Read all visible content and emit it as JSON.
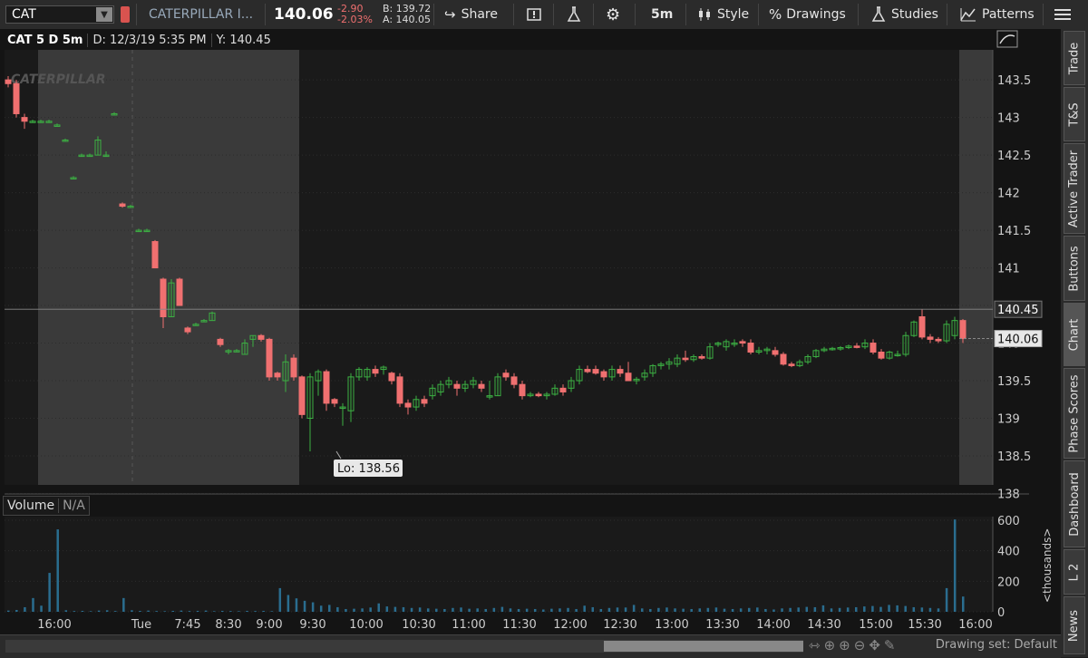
{
  "toolbar": {
    "symbol": "CAT",
    "company": "CATERPILLAR I...",
    "last": "140.06",
    "change": "-2.90",
    "change_pct": "-2.03%",
    "bid": "B: 139.72",
    "ask": "A: 140.05",
    "share": "Share",
    "interval": "5m",
    "style": "Style",
    "drawings": "Drawings",
    "studies": "Studies",
    "patterns": "Patterns"
  },
  "header": {
    "title": "CAT 5 D 5m",
    "date": "D: 12/3/19 5:35 PM",
    "y": "Y: 140.45"
  },
  "watermark": "CATERPILLAR",
  "annotations": {
    "low": "Lo: 138.56",
    "marker_current": "140.06",
    "marker_cursor": "140.45"
  },
  "volume_panel": {
    "label": "Volume",
    "value": "N/A",
    "unit": "<thousands>"
  },
  "side_tabs": [
    "Trade",
    "T&S",
    "Active Trader",
    "Buttons",
    "Chart",
    "Phase Scores",
    "Dashboard",
    "L 2",
    "News"
  ],
  "bottom": {
    "drawing_set": "Drawing set: Default"
  },
  "colors": {
    "up": "#3cb043",
    "down": "#f07070",
    "volume": "#2a6d8f",
    "background": "#141414"
  },
  "chart_data": {
    "type": "candlestick",
    "ylim": [
      138,
      143.75
    ],
    "yticks": [
      143.5,
      143,
      142.5,
      142,
      141.5,
      141,
      140.5,
      140,
      139.5,
      139,
      138.5,
      138
    ],
    "xticks": [
      "16:00",
      "Tue",
      "7:45",
      "8:30",
      "9:00",
      "9:30",
      "10:00",
      "10:30",
      "11:00",
      "11:30",
      "12:00",
      "12:30",
      "13:00",
      "13:30",
      "14:00",
      "14:30",
      "15:00",
      "15:30",
      "16:00"
    ],
    "volume_ylim": [
      0,
      600
    ],
    "volume_yticks": [
      600,
      400,
      200,
      0
    ],
    "candles": [
      [
        143.5,
        143.55,
        143.4,
        143.45
      ],
      [
        143.45,
        143.5,
        143.0,
        143.05
      ],
      [
        143.0,
        143.05,
        142.85,
        142.95
      ],
      [
        142.95,
        142.97,
        142.93,
        142.95
      ],
      [
        142.95,
        142.97,
        142.93,
        142.95
      ],
      [
        142.95,
        142.97,
        142.93,
        142.95
      ],
      [
        142.9,
        142.92,
        142.88,
        142.9
      ],
      [
        142.7,
        142.72,
        142.68,
        142.7
      ],
      [
        142.2,
        142.22,
        142.18,
        142.2
      ],
      [
        142.5,
        142.52,
        142.48,
        142.5
      ],
      [
        142.5,
        142.52,
        142.48,
        142.5
      ],
      [
        142.5,
        142.75,
        142.5,
        142.7
      ],
      [
        142.5,
        142.55,
        142.48,
        142.5
      ],
      [
        143.05,
        143.07,
        143.03,
        143.05
      ],
      [
        141.85,
        141.87,
        141.8,
        141.82
      ],
      [
        141.82,
        141.84,
        141.8,
        141.82
      ],
      [
        141.5,
        141.52,
        141.48,
        141.5
      ],
      [
        141.5,
        141.52,
        141.48,
        141.5
      ],
      [
        141.35,
        141.37,
        141.0,
        141.0
      ],
      [
        140.85,
        140.87,
        140.2,
        140.35
      ],
      [
        140.35,
        140.85,
        140.35,
        140.8
      ],
      [
        140.85,
        140.87,
        140.5,
        140.5
      ],
      [
        140.2,
        140.22,
        140.12,
        140.15
      ],
      [
        140.25,
        140.27,
        140.23,
        140.25
      ],
      [
        140.3,
        140.32,
        140.28,
        140.3
      ],
      [
        140.3,
        140.42,
        140.3,
        140.4
      ],
      [
        140.05,
        140.07,
        139.95,
        139.98
      ],
      [
        139.9,
        139.92,
        139.85,
        139.9
      ],
      [
        139.9,
        139.92,
        139.88,
        139.9
      ],
      [
        139.85,
        140.05,
        139.85,
        140.0
      ],
      [
        140.05,
        140.1,
        139.95,
        140.1
      ],
      [
        140.1,
        140.12,
        140.02,
        140.05
      ],
      [
        140.05,
        140.07,
        139.5,
        139.55
      ],
      [
        139.6,
        139.62,
        139.5,
        139.55
      ],
      [
        139.5,
        139.85,
        139.35,
        139.75
      ],
      [
        139.8,
        139.85,
        139.5,
        139.55
      ],
      [
        139.55,
        139.57,
        139.0,
        139.05
      ],
      [
        139.0,
        139.6,
        138.56,
        139.55
      ],
      [
        139.5,
        139.65,
        139.3,
        139.62
      ],
      [
        139.62,
        139.65,
        139.1,
        139.2
      ],
      [
        139.25,
        139.27,
        139.15,
        139.2
      ],
      [
        139.15,
        139.2,
        138.9,
        139.15
      ],
      [
        139.1,
        139.6,
        138.95,
        139.55
      ],
      [
        139.55,
        139.68,
        139.5,
        139.65
      ],
      [
        139.55,
        139.68,
        139.5,
        139.65
      ],
      [
        139.65,
        139.7,
        139.55,
        139.6
      ],
      [
        139.65,
        139.7,
        139.58,
        139.68
      ],
      [
        139.6,
        139.62,
        139.45,
        139.5
      ],
      [
        139.55,
        139.6,
        139.15,
        139.2
      ],
      [
        139.2,
        139.25,
        139.05,
        139.15
      ],
      [
        139.15,
        139.3,
        139.1,
        139.25
      ],
      [
        139.25,
        139.3,
        139.15,
        139.2
      ],
      [
        139.3,
        139.45,
        139.25,
        139.4
      ],
      [
        139.35,
        139.5,
        139.3,
        139.45
      ],
      [
        139.45,
        139.55,
        139.4,
        139.5
      ],
      [
        139.45,
        139.5,
        139.3,
        139.4
      ],
      [
        139.4,
        139.5,
        139.35,
        139.45
      ],
      [
        139.45,
        139.55,
        139.4,
        139.5
      ],
      [
        139.45,
        139.5,
        139.35,
        139.4
      ],
      [
        139.3,
        139.5,
        139.25,
        139.3
      ],
      [
        139.3,
        139.6,
        139.3,
        139.55
      ],
      [
        139.6,
        139.65,
        139.5,
        139.55
      ],
      [
        139.55,
        139.6,
        139.4,
        139.45
      ],
      [
        139.45,
        139.5,
        139.25,
        139.3
      ],
      [
        139.3,
        139.35,
        139.28,
        139.32
      ],
      [
        139.32,
        139.35,
        139.28,
        139.3
      ],
      [
        139.3,
        139.35,
        139.25,
        139.32
      ],
      [
        139.32,
        139.45,
        139.3,
        139.4
      ],
      [
        139.4,
        139.45,
        139.3,
        139.35
      ],
      [
        139.4,
        139.55,
        139.35,
        139.5
      ],
      [
        139.5,
        139.7,
        139.45,
        139.65
      ],
      [
        139.65,
        139.7,
        139.6,
        139.62
      ],
      [
        139.65,
        139.7,
        139.58,
        139.6
      ],
      [
        139.62,
        139.65,
        139.5,
        139.55
      ],
      [
        139.55,
        139.7,
        139.5,
        139.65
      ],
      [
        139.65,
        139.7,
        139.55,
        139.6
      ],
      [
        139.6,
        139.75,
        139.5,
        139.5
      ],
      [
        139.5,
        139.55,
        139.45,
        139.52
      ],
      [
        139.55,
        139.65,
        139.5,
        139.6
      ],
      [
        139.6,
        139.72,
        139.55,
        139.7
      ],
      [
        139.7,
        139.75,
        139.65,
        139.72
      ],
      [
        139.72,
        139.8,
        139.65,
        139.75
      ],
      [
        139.72,
        139.85,
        139.68,
        139.8
      ],
      [
        139.8,
        139.9,
        139.75,
        139.78
      ],
      [
        139.78,
        139.85,
        139.75,
        139.82
      ],
      [
        139.82,
        139.85,
        139.78,
        139.8
      ],
      [
        139.8,
        140.0,
        139.78,
        139.95
      ],
      [
        139.98,
        140.02,
        139.95,
        140.0
      ],
      [
        139.95,
        140.05,
        139.9,
        140.02
      ],
      [
        140.0,
        140.05,
        139.95,
        140.0
      ],
      [
        140.02,
        140.05,
        139.95,
        140.0
      ],
      [
        140.0,
        140.05,
        139.85,
        139.88
      ],
      [
        139.88,
        139.95,
        139.85,
        139.9
      ],
      [
        139.9,
        139.95,
        139.85,
        139.92
      ],
      [
        139.9,
        139.95,
        139.82,
        139.85
      ],
      [
        139.85,
        139.88,
        139.7,
        139.72
      ],
      [
        139.72,
        139.75,
        139.68,
        139.7
      ],
      [
        139.7,
        139.78,
        139.68,
        139.75
      ],
      [
        139.75,
        139.85,
        139.72,
        139.82
      ],
      [
        139.82,
        139.92,
        139.8,
        139.9
      ],
      [
        139.9,
        139.95,
        139.88,
        139.92
      ],
      [
        139.92,
        139.95,
        139.9,
        139.93
      ],
      [
        139.93,
        139.96,
        139.9,
        139.94
      ],
      [
        139.94,
        139.98,
        139.92,
        139.96
      ],
      [
        139.96,
        140.0,
        139.93,
        139.95
      ],
      [
        139.95,
        140.05,
        139.92,
        140.0
      ],
      [
        140.0,
        140.05,
        139.85,
        139.88
      ],
      [
        139.88,
        139.92,
        139.78,
        139.8
      ],
      [
        139.8,
        139.9,
        139.78,
        139.88
      ],
      [
        139.85,
        139.9,
        139.82,
        139.85
      ],
      [
        139.85,
        140.15,
        139.82,
        140.1
      ],
      [
        140.1,
        140.3,
        140.08,
        140.28
      ],
      [
        140.35,
        140.45,
        140.05,
        140.08
      ],
      [
        140.08,
        140.12,
        140.0,
        140.05
      ],
      [
        140.05,
        140.08,
        140.0,
        140.03
      ],
      [
        140.03,
        140.3,
        140.0,
        140.25
      ],
      [
        140.1,
        140.35,
        140.05,
        140.3
      ],
      [
        140.3,
        140.32,
        140.0,
        140.06
      ]
    ],
    "volume": [
      8,
      12,
      30,
      90,
      40,
      255,
      540,
      10,
      5,
      6,
      4,
      8,
      10,
      5,
      90,
      10,
      6,
      8,
      5,
      4,
      6,
      8,
      5,
      6,
      8,
      4,
      6,
      5,
      4,
      6,
      5,
      6,
      4,
      155,
      110,
      88,
      72,
      62,
      40,
      45,
      30,
      18,
      20,
      22,
      28,
      55,
      35,
      32,
      30,
      25,
      28,
      22,
      20,
      18,
      25,
      28,
      20,
      22,
      18,
      25,
      32,
      22,
      18,
      20,
      18,
      15,
      20,
      22,
      25,
      18,
      40,
      30,
      18,
      25,
      28,
      28,
      45,
      22,
      18,
      25,
      28,
      22,
      20,
      18,
      22,
      25,
      28,
      20,
      18,
      22,
      25,
      28,
      18,
      15,
      22,
      25,
      28,
      32,
      30,
      42,
      22,
      25,
      28,
      30,
      35,
      38,
      32,
      45,
      42,
      38,
      30,
      28,
      25,
      22,
      155,
      605,
      100
    ]
  }
}
